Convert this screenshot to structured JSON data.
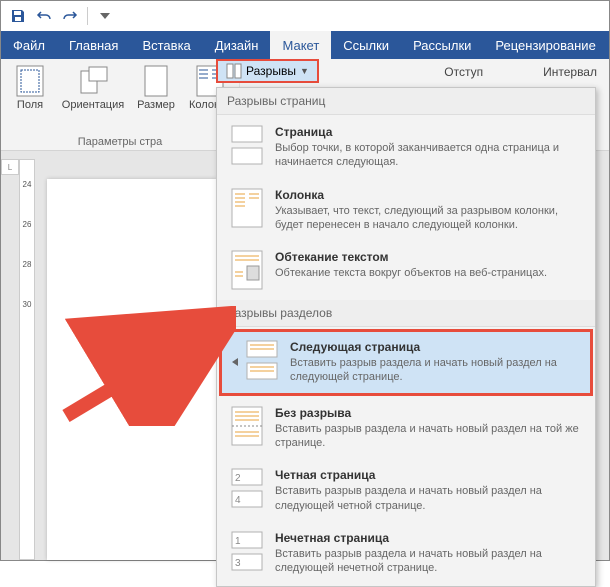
{
  "titlebar": {
    "save": "Save",
    "undo": "Undo",
    "redo": "Redo"
  },
  "tabs": {
    "file": "Файл",
    "home": "Главная",
    "insert": "Вставка",
    "design": "Дизайн",
    "layout": "Макет",
    "references": "Ссылки",
    "mailings": "Рассылки",
    "review": "Рецензирование"
  },
  "ribbon": {
    "margins": "Поля",
    "orientation": "Ориентация",
    "size": "Размер",
    "columns": "Колонки",
    "group_page_setup": "Параметры стра",
    "breaks": "Разрывы",
    "indent": "Отступ",
    "spacing": "Интервал"
  },
  "dropdown": {
    "section1_header": "Разрывы страниц",
    "items1": [
      {
        "title": "Страница",
        "desc": "Выбор точки, в которой заканчивается одна страница и начинается следующая."
      },
      {
        "title": "Колонка",
        "desc": "Указывает, что текст, следующий за разрывом колонки, будет перенесен в начало следующей колонки."
      },
      {
        "title": "Обтекание текстом",
        "desc": "Обтекание текста вокруг объектов на веб-страницах."
      }
    ],
    "section2_header": "Разрывы разделов",
    "items2": [
      {
        "title": "Следующая страница",
        "desc": "Вставить разрыв раздела и начать новый раздел на следующей странице."
      },
      {
        "title": "Без разрыва",
        "desc": "Вставить разрыв раздела и начать новый раздел на той же странице."
      },
      {
        "title": "Четная страница",
        "desc": "Вставить разрыв раздела и начать новый раздел на следующей четной странице."
      },
      {
        "title": "Нечетная страница",
        "desc": "Вставить разрыв раздела и начать новый раздел на следующей нечетной странице."
      }
    ]
  },
  "ruler_corner": "L",
  "ruler_ticks": [
    "24",
    "26",
    "28",
    "30"
  ],
  "colors": {
    "accent": "#2b579a",
    "highlight": "#e74c3c",
    "ribbon_bg": "#f3f3f3"
  }
}
